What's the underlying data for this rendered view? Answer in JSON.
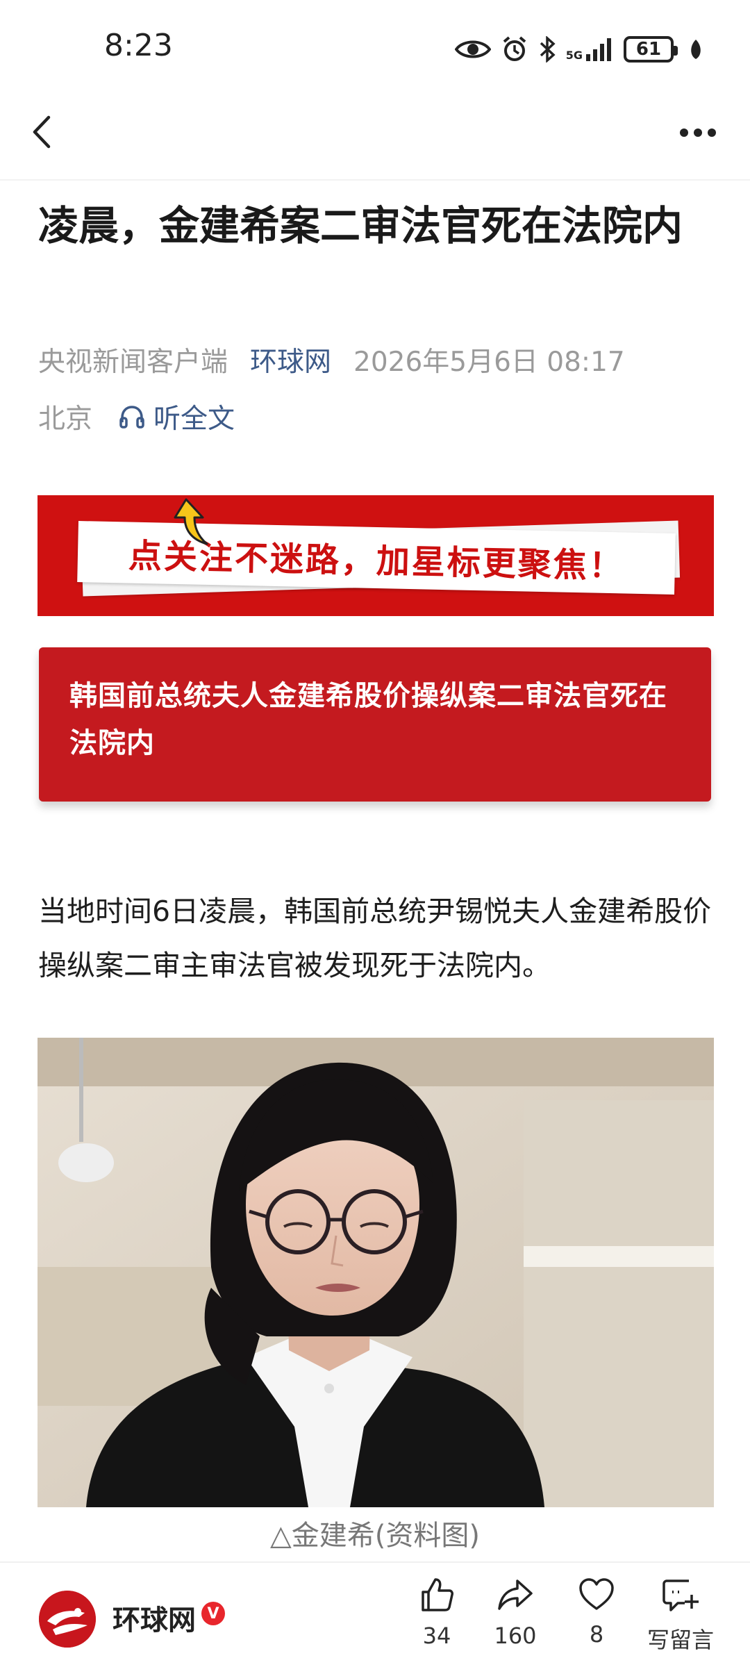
{
  "status_bar": {
    "time": "8:23",
    "network": "5G",
    "battery": "61"
  },
  "nav": {
    "back_icon": "back-chevron-icon",
    "more_icon": "more-dots-icon"
  },
  "article": {
    "title": "凌晨，金建希案二审法官死在法院内",
    "source_primary": "央视新闻客户端",
    "source_secondary": "环球网",
    "date": "2026年5月6日 08:17",
    "location": "北京",
    "listen_label": "听全文",
    "follow_banner_text": "点关注不迷路，加星标更聚焦！",
    "summary": "韩国前总统夫人金建希股价操纵案二审法官死在法院内",
    "paragraph": "当地时间6日凌晨，韩国前总统尹锡悦夫人金建希股价操纵案二审主审法官被发现死于法院内。",
    "photo_caption": "△金建希(资料图)"
  },
  "bottom_bar": {
    "author_name": "环球网",
    "verified_badge": "V",
    "actions": [
      {
        "icon": "thumbs-up-icon",
        "label": "34"
      },
      {
        "icon": "share-icon",
        "label": "160"
      },
      {
        "icon": "heart-icon",
        "label": "8"
      },
      {
        "icon": "comment-add-icon",
        "label": "写留言"
      }
    ]
  },
  "colors": {
    "accent_red": "#cf1111",
    "summary_red": "#c41a1f",
    "link_blue": "#3d5a88",
    "meta_gray": "#9a9a9a"
  }
}
